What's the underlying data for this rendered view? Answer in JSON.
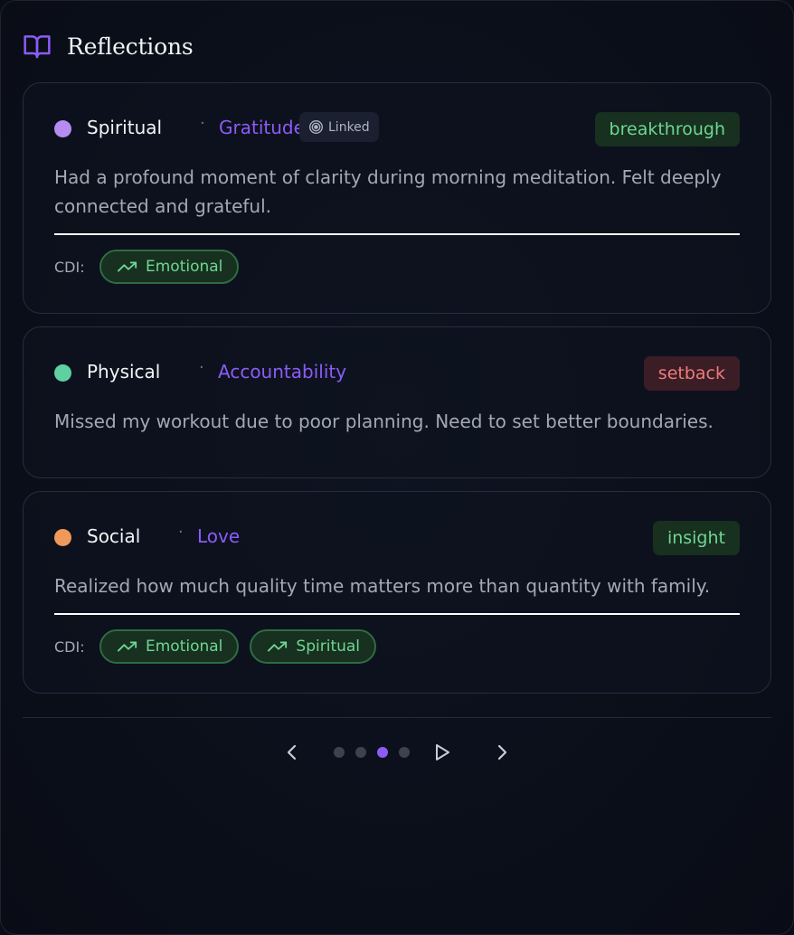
{
  "header": {
    "title": "Reflections",
    "icon": "book-open-icon",
    "icon_color": "#8b5cf6"
  },
  "cards": [
    {
      "domain": "Spiritual",
      "domain_color": "#b48cf2",
      "value": "Gratitude",
      "linked_label": "Linked",
      "tag": "breakthrough",
      "tag_type": "positive",
      "text": "Had a profound moment of clarity during morning meditation. Felt deeply connected and grateful.",
      "cdi_label": "CDI:",
      "cdi": [
        "Emotional"
      ]
    },
    {
      "domain": "Physical",
      "domain_color": "#5fd0a0",
      "value": "Accountability",
      "tag": "setback",
      "tag_type": "negative",
      "text": "Missed my workout due to poor planning. Need to set better boundaries."
    },
    {
      "domain": "Social",
      "domain_color": "#f0995a",
      "value": "Love",
      "tag": "insight",
      "tag_type": "positive",
      "text": "Realized how much quality time matters more than quantity with family.",
      "cdi_label": "CDI:",
      "cdi": [
        "Emotional",
        "Spiritual"
      ]
    }
  ],
  "pagination": {
    "total_pages": 4,
    "current_page": 3,
    "prev_icon": "chevron-left-icon",
    "play_icon": "play-icon",
    "next_icon": "chevron-right-icon"
  },
  "colors": {
    "accent": "#8b5cf6",
    "positive_bg": "#17301f",
    "positive_text": "#6fd693",
    "negative_bg": "#3a1d25",
    "negative_text": "#ef7b7b"
  }
}
